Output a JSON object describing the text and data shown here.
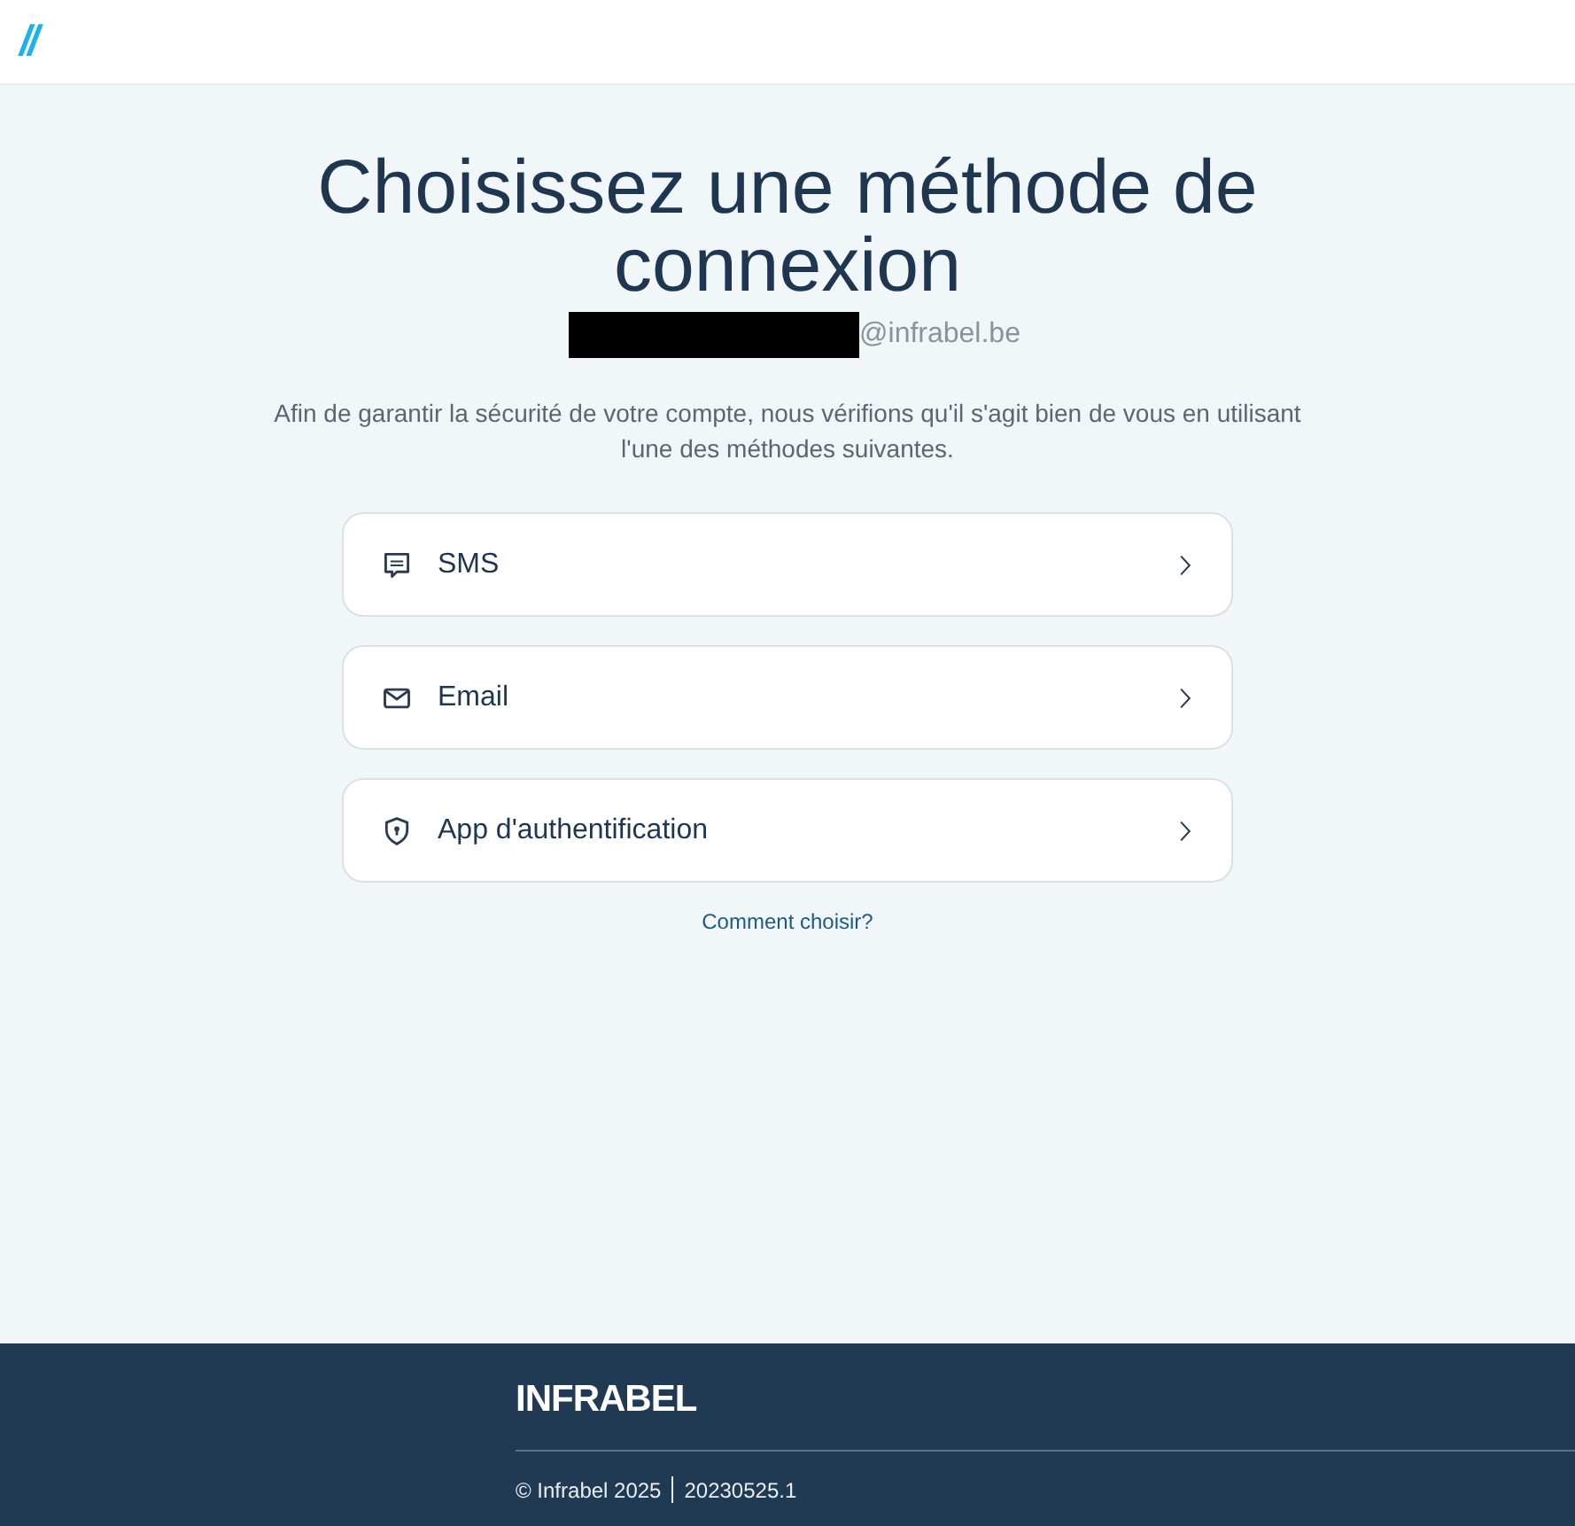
{
  "header": {
    "logo_mark": "//"
  },
  "title": "Choisissez une méthode de connexion",
  "account": {
    "redacted": true,
    "domain": "@infrabel.be"
  },
  "description": "Afin de garantir la sécurité de votre compte, nous vérifions qu'il s'agit bien de vous en utilisant l'une des méthodes suivantes.",
  "methods": [
    {
      "kind": "sms",
      "label": "SMS"
    },
    {
      "kind": "email",
      "label": "Email"
    },
    {
      "kind": "app",
      "label": "App d'authentification"
    }
  ],
  "help_link": "Comment choisir?",
  "footer": {
    "brand": "INFRABEL",
    "copyright": "© Infrabel 2025",
    "version": "20230525.1"
  }
}
